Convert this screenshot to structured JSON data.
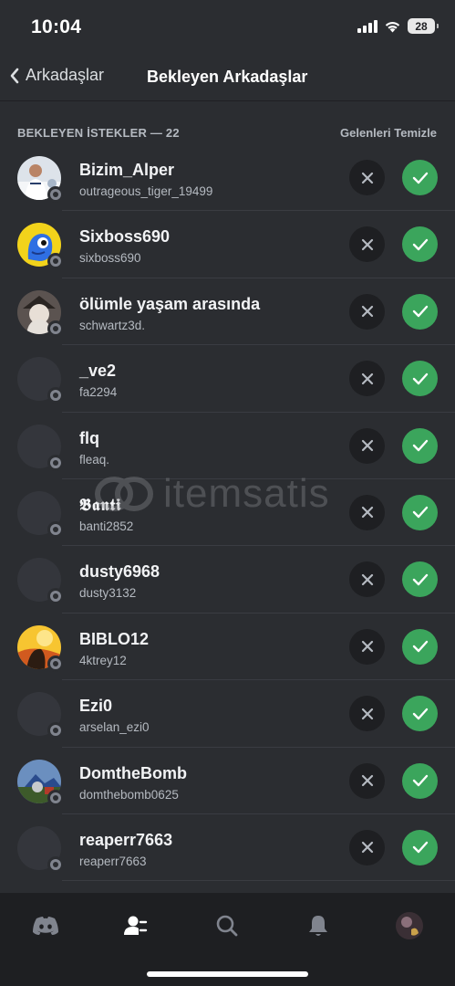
{
  "status_bar": {
    "time": "10:04",
    "battery": "28"
  },
  "header": {
    "back_label": "Arkadaşlar",
    "title": "Bekleyen Arkadaşlar"
  },
  "section": {
    "title": "BEKLEYEN İSTEKLER — 22",
    "clear_label": "Gelenleri Temizle"
  },
  "requests": [
    {
      "name": "Bizim_Alper",
      "username": "outrageous_tiger_19499",
      "avatar": "photo-player"
    },
    {
      "name": "Sixboss690",
      "username": "sixboss690",
      "avatar": "blue-cartoon"
    },
    {
      "name": "ölümle yaşam arasında",
      "username": "schwartz3d.",
      "avatar": "photo-hat"
    },
    {
      "name": "_ve2",
      "username": "fa2294",
      "avatar": "blank"
    },
    {
      "name": "flq",
      "username": "fleaq.",
      "avatar": "blank"
    },
    {
      "name": "𝕭𝖆𝖓𝖙𝖎",
      "username": "banti2852",
      "avatar": "blank"
    },
    {
      "name": "dusty6968",
      "username": "dusty3132",
      "avatar": "blank"
    },
    {
      "name": "BIBLO12",
      "username": "4ktrey12",
      "avatar": "sunset"
    },
    {
      "name": "Ezi0",
      "username": "arselan_ezi0",
      "avatar": "blank"
    },
    {
      "name": "DomtheBomb",
      "username": "domthebomb0625",
      "avatar": "game-scene"
    },
    {
      "name": "reaperr7663",
      "username": "reaperr7663",
      "avatar": "blank"
    }
  ],
  "watermark": {
    "text": "itemsatis"
  },
  "tabbar": {
    "items": [
      "discord-icon",
      "friends-icon",
      "search-icon",
      "bell-icon",
      "profile-avatar"
    ],
    "active": "friends-icon"
  },
  "colors": {
    "background": "#2b2d31",
    "accept": "#3ba55c",
    "decline": "#1e1f22",
    "tabbar": "#1e1f22"
  }
}
